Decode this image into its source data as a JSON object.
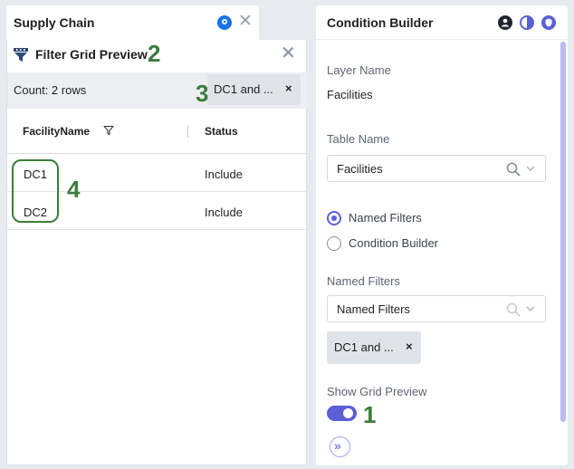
{
  "left_tab": {
    "title": "Supply Chain",
    "pin_icon": "map-pin-icon",
    "close_icon": "close-icon"
  },
  "preview": {
    "title": "Filter Grid Preview",
    "icon": "filter-grid-icon",
    "close_icon": "close-icon",
    "count_text": "Count: 2 rows",
    "chip_label": "DC1 and ...",
    "chip_remove": "×"
  },
  "grid": {
    "columns": [
      {
        "label": "FacilityName",
        "icon": "filter-icon"
      },
      {
        "label": "Status"
      }
    ],
    "rows": [
      {
        "name": "DC1",
        "status": "Include"
      },
      {
        "name": "DC2",
        "status": "Include"
      }
    ]
  },
  "callouts": {
    "one": "1",
    "two": "2",
    "three": "3",
    "four": "4",
    "color": "#3c7d3c"
  },
  "condition_builder": {
    "title": "Condition Builder",
    "header_icons": [
      "user-icon",
      "contrast-icon",
      "shield-icon"
    ],
    "layer_name_label": "Layer Name",
    "layer_name_value": "Facilities",
    "table_name_label": "Table Name",
    "table_name_value": "Facilities",
    "radio_named_filters": "Named Filters",
    "radio_condition_builder": "Condition Builder",
    "named_filters_label": "Named Filters",
    "named_filters_select": "Named Filters",
    "chip_label": "DC1 and ...",
    "chip_remove": "×",
    "show_grid_preview_label": "Show Grid Preview",
    "show_grid_preview_on": true,
    "expand_icon": "double-chevron-right-icon"
  },
  "colors": {
    "accent": "#5b5fd6",
    "callout": "#3c7d3c",
    "panel_bg": "#ffffff",
    "page_bg": "#e8eaf0"
  }
}
